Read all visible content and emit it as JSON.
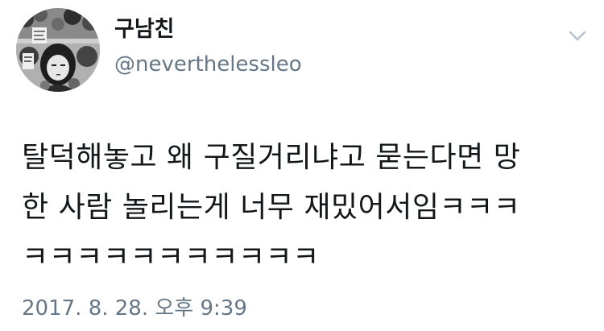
{
  "tweet": {
    "display_name": "구남친",
    "handle": "@neverthelessleo",
    "text_lines": [
      "탈덕해놓고 왜 구질거리냐고 묻는다면 망",
      "한 사람 놀리는게 너무 재밌어서임ㅋㅋㅋ",
      "ㅋㅋㅋㅋㅋㅋㅋㅋㅋㅋㅋ"
    ],
    "timestamp": "2017. 8. 28. 오후 9:39",
    "menu_icon": "chevron-down-icon",
    "avatar_icon": "profile-avatar"
  },
  "colors": {
    "text": "#14171a",
    "secondary": "#657786",
    "caret": "#b8c2cc"
  }
}
